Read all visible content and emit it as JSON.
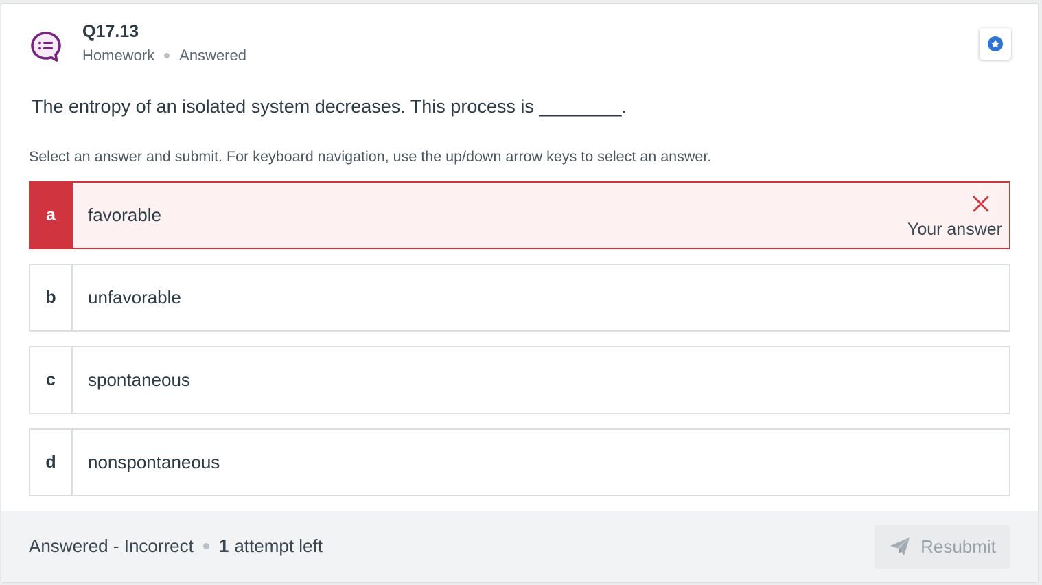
{
  "question": {
    "number": "Q17.13",
    "type": "Homework",
    "state": "Answered",
    "prompt": "The entropy of an isolated system decreases. This process is ________.",
    "instructions": "Select an answer and submit. For keyboard navigation, use the up/down arrow keys to select an answer."
  },
  "choices": [
    {
      "letter": "a",
      "text": "favorable",
      "selected": true,
      "incorrect": true,
      "feedback": "Your answer"
    },
    {
      "letter": "b",
      "text": "unfavorable"
    },
    {
      "letter": "c",
      "text": "spontaneous"
    },
    {
      "letter": "d",
      "text": "nonspontaneous"
    }
  ],
  "footer": {
    "status": "Answered - Incorrect",
    "attempts_count": "1",
    "attempts_suffix": "attempt left",
    "resubmit_label": "Resubmit"
  },
  "colors": {
    "accent_purple": "#7b2382",
    "incorrect_red": "#d0343f",
    "bookmark_blue": "#2d74d4"
  },
  "icons": {
    "question_type": "discussion-list-icon",
    "bookmark": "star-bookmark-icon",
    "incorrect": "close-icon",
    "resubmit": "paper-plane-icon"
  }
}
